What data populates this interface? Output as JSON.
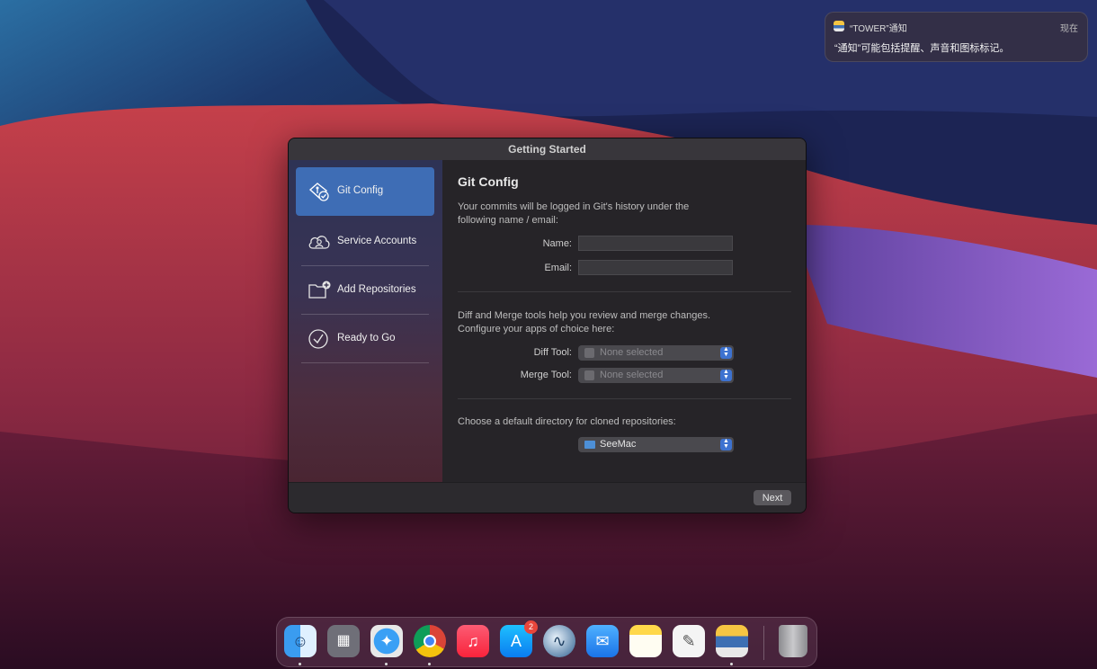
{
  "notification": {
    "app": "“TOWER”通知",
    "time": "现在",
    "message": "“通知”可能包括提醒、声音和图标标记。"
  },
  "window": {
    "title": "Getting Started",
    "sidebar": {
      "items": [
        {
          "label": "Git Config",
          "icon": "git-config-icon",
          "active": true
        },
        {
          "label": "Service Accounts",
          "icon": "cloud-user-icon",
          "active": false
        },
        {
          "label": "Add Repositories",
          "icon": "folder-add-icon",
          "active": false
        },
        {
          "label": "Ready to Go",
          "icon": "checkmark-circle-icon",
          "active": false
        }
      ]
    },
    "main": {
      "heading": "Git Config",
      "identity_desc": "Your commits will be logged in Git's history under the following name / email:",
      "name_label": "Name:",
      "name_value": "",
      "email_label": "Email:",
      "email_value": "",
      "tools_desc": "Diff and Merge tools help you review and merge changes. Configure your apps of choice here:",
      "diff_label": "Diff Tool:",
      "diff_value": "None selected",
      "merge_label": "Merge Tool:",
      "merge_value": "None selected",
      "dir_desc": "Choose a default directory for cloned repositories:",
      "dir_value": "SeeMac"
    },
    "footer": {
      "next_label": "Next"
    }
  },
  "dock": {
    "apps": [
      {
        "name": "Finder",
        "icon": "finder-icon",
        "running": true
      },
      {
        "name": "Launchpad",
        "icon": "launchpad-icon",
        "running": false
      },
      {
        "name": "Safari",
        "icon": "safari-icon",
        "running": true
      },
      {
        "name": "Chrome",
        "icon": "chrome-icon",
        "running": true
      },
      {
        "name": "Music",
        "icon": "music-icon",
        "running": false
      },
      {
        "name": "App Store",
        "icon": "app-store-icon",
        "running": false,
        "badge": "2"
      },
      {
        "name": "SeaMonkey",
        "icon": "seamonkey-icon",
        "running": false
      },
      {
        "name": "Mail",
        "icon": "mail-icon",
        "running": false
      },
      {
        "name": "Notes",
        "icon": "notes-icon",
        "running": false
      },
      {
        "name": "TextEdit",
        "icon": "textedit-icon",
        "running": false
      },
      {
        "name": "Tower",
        "icon": "tower-icon",
        "running": true
      },
      {
        "name": "Trash",
        "icon": "trash-icon",
        "running": false
      }
    ]
  },
  "colors": {
    "accent": "#3e6db5",
    "window_bg": "#262428",
    "badge": "#e8463b"
  }
}
